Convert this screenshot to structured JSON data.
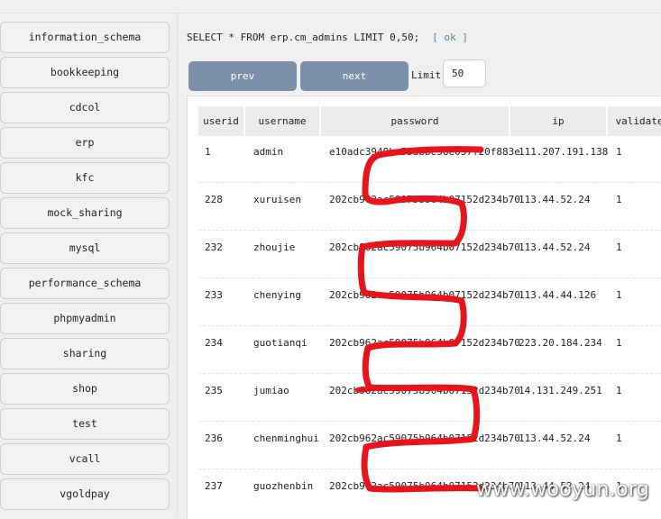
{
  "sidebar": {
    "databases": [
      "information_schema",
      "bookkeeping",
      "cdcol",
      "erp",
      "kfc",
      "mock_sharing",
      "mysql",
      "performance_schema",
      "phpmyadmin",
      "sharing",
      "shop",
      "test",
      "vcall",
      "vgoldpay"
    ]
  },
  "query": {
    "sql": "SELECT * FROM erp.cm_admins LIMIT 0,50;",
    "status": "[ ok ]"
  },
  "pager": {
    "prev_label": "prev",
    "next_label": "next",
    "limit_label": "Limit",
    "limit_value": "50"
  },
  "table": {
    "columns": [
      "userid",
      "username",
      "password",
      "ip",
      "validate"
    ],
    "rows": [
      {
        "userid": "1",
        "username": "admin",
        "password": "e10adc3949ba59abbe56e057f20f883e",
        "ip": "111.207.191.138",
        "validate": "1"
      },
      {
        "userid": "228",
        "username": "xuruisen",
        "password": "202cb962ac59075b964b07152d234b70",
        "ip": "113.44.52.24",
        "validate": "1"
      },
      {
        "userid": "232",
        "username": "zhoujie",
        "password": "202cb962ac59075b964b07152d234b70",
        "ip": "113.44.52.24",
        "validate": "1"
      },
      {
        "userid": "233",
        "username": "chenying",
        "password": "202cb962ac59075b964b07152d234b70",
        "ip": "113.44.44.126",
        "validate": "1"
      },
      {
        "userid": "234",
        "username": "guotianqi",
        "password": "202cb962ac59075b964b07152d234b70",
        "ip": "223.20.184.234",
        "validate": "1"
      },
      {
        "userid": "235",
        "username": "jumiao",
        "password": "202cb962ac59075b964b07152d234b70",
        "ip": "14.131.249.251",
        "validate": "1"
      },
      {
        "userid": "236",
        "username": "chenminghui",
        "password": "202cb962ac59075b964b07152d234b70",
        "ip": "113.44.52.24",
        "validate": "1"
      },
      {
        "userid": "237",
        "username": "guozhenbin",
        "password": "202cb962ac59075b964b07152d234b70",
        "ip": "113.44.52.24",
        "validate": "1"
      }
    ]
  },
  "watermark": "www.wooyun.org",
  "colors": {
    "button_bg": "#7a91a9",
    "header_bg": "#ececec",
    "redaction": "#e8141c"
  }
}
